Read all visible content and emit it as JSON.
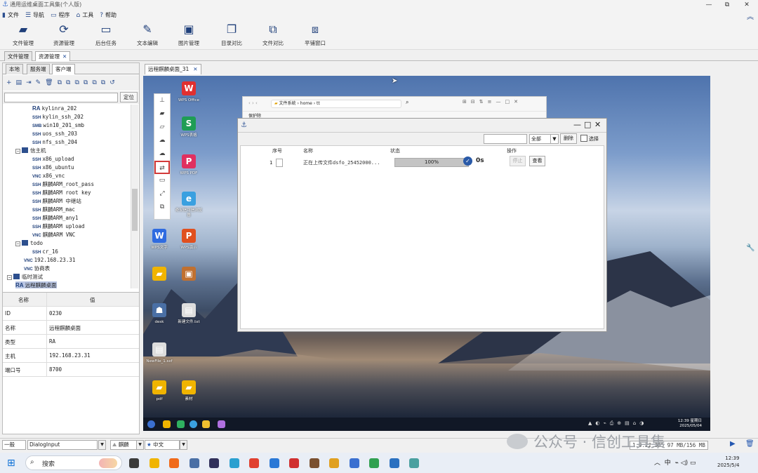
{
  "window": {
    "title": "通用运维桌面工具集(个人版)",
    "controls": [
      "—",
      "⧉",
      "✕"
    ]
  },
  "menu": [
    {
      "icon": "file-icon",
      "glyph": "▮",
      "label": "文件"
    },
    {
      "icon": "nav-icon",
      "glyph": "☰",
      "label": "导航"
    },
    {
      "icon": "program-icon",
      "glyph": "▭",
      "label": "程序"
    },
    {
      "icon": "tools-icon",
      "glyph": "⌂",
      "label": "工具"
    },
    {
      "icon": "help-icon",
      "glyph": "?",
      "label": "帮助"
    }
  ],
  "toolbar": [
    {
      "icon": "folder-open-icon",
      "glyph": "▰",
      "label": "文件管理"
    },
    {
      "icon": "resource-icon",
      "glyph": "⟳",
      "label": "资源管理"
    },
    {
      "icon": "monitor-icon",
      "glyph": "▭",
      "label": "后台任务"
    },
    {
      "icon": "edit-icon",
      "glyph": "✎",
      "label": "文本编辑"
    },
    {
      "icon": "image-icon",
      "glyph": "▣",
      "label": "图片管理"
    },
    {
      "icon": "dir-compare-icon",
      "glyph": "❐",
      "label": "目录对比"
    },
    {
      "icon": "file-compare-icon",
      "glyph": "⧉",
      "label": "文件对比"
    },
    {
      "icon": "tile-window-icon",
      "glyph": "⧈",
      "label": "平铺窗口"
    }
  ],
  "module_tabs": [
    {
      "label": "文件管理",
      "closable": false
    },
    {
      "label": "资源管理",
      "closable": true
    }
  ],
  "left": {
    "tabs": [
      "本地",
      "服务端",
      "客户端"
    ],
    "tools": [
      "+",
      "▤",
      "⇥",
      "✎",
      "🗑",
      "⧉",
      "⧉",
      "⧉",
      "⧉",
      "⧉",
      "⧉",
      "↺"
    ],
    "locate": "定位",
    "tree": [
      {
        "proto": "RA",
        "label": "kylinra_202",
        "indent": 42,
        "kind": "leaf"
      },
      {
        "proto": "SSH",
        "label": "kylin_ssh_202",
        "indent": 42,
        "kind": "leaf"
      },
      {
        "proto": "SMB",
        "label": "win10_201_smb",
        "indent": 42,
        "kind": "leaf"
      },
      {
        "proto": "SSH",
        "label": "uos_ssh_203",
        "indent": 42,
        "kind": "leaf"
      },
      {
        "proto": "SSH",
        "label": "nfs_ssh_204",
        "indent": 42,
        "kind": "leaf"
      },
      {
        "proto": "",
        "label": "信主机",
        "indent": 18,
        "kind": "folder"
      },
      {
        "proto": "SSH",
        "label": "x86_upload",
        "indent": 42,
        "kind": "leaf"
      },
      {
        "proto": "SSH",
        "label": "x86_ubuntu",
        "indent": 42,
        "kind": "leaf"
      },
      {
        "proto": "VNC",
        "label": "x86_vnc",
        "indent": 42,
        "kind": "leaf"
      },
      {
        "proto": "SSH",
        "label": "麒麟ARM_root_pass",
        "indent": 42,
        "kind": "leaf"
      },
      {
        "proto": "SSH",
        "label": "麒麟ARM root key",
        "indent": 42,
        "kind": "leaf"
      },
      {
        "proto": "SSH",
        "label": "麒麟ARM 中继站",
        "indent": 42,
        "kind": "leaf"
      },
      {
        "proto": "SSH",
        "label": "麒麟ARM_mac",
        "indent": 42,
        "kind": "leaf"
      },
      {
        "proto": "SSH",
        "label": "麒麟ARM_any1",
        "indent": 42,
        "kind": "leaf"
      },
      {
        "proto": "SSH",
        "label": "麒麟ARM upload",
        "indent": 42,
        "kind": "leaf"
      },
      {
        "proto": "VNC",
        "label": "麒麟ARM VNC",
        "indent": 42,
        "kind": "leaf"
      },
      {
        "proto": "",
        "label": "todo",
        "indent": 18,
        "kind": "folder"
      },
      {
        "proto": "SSH",
        "label": "cr_16",
        "indent": 42,
        "kind": "leaf"
      },
      {
        "proto": "VNC",
        "label": "192.168.23.31",
        "indent": 30,
        "kind": "leaf"
      },
      {
        "proto": "VNC",
        "label": "协商表",
        "indent": 30,
        "kind": "leaf"
      },
      {
        "proto": "",
        "label": "临时测试",
        "indent": 6,
        "kind": "folder"
      },
      {
        "proto": "RA",
        "label": "远程麒麟桌面",
        "indent": 18,
        "kind": "leaf",
        "selected": true
      }
    ],
    "props_header": {
      "name": "名称",
      "value": "值"
    },
    "props": [
      {
        "k": "ID",
        "v": "0230"
      },
      {
        "k": "名称",
        "v": "远程麒麟桌面"
      },
      {
        "k": "类型",
        "v": "RA"
      },
      {
        "k": "主机",
        "v": "192.168.23.31"
      },
      {
        "k": "端口号",
        "v": "8700"
      }
    ]
  },
  "content_tab": {
    "label": "远程麒麟桌面_31"
  },
  "remote": {
    "icons_col1": [
      {
        "label": "WPS文字",
        "color": "#2f6be0",
        "glyph": "W"
      },
      {
        "label": "",
        "color": "#f0b400",
        "glyph": "▰"
      },
      {
        "label": "desk",
        "color": "#4a6fa5",
        "glyph": "☗"
      },
      {
        "label": "NewFile_1.sxf",
        "color": "#dddddd",
        "glyph": "▤"
      },
      {
        "label": "pdf",
        "color": "#f0b400",
        "glyph": "▰"
      }
    ],
    "icons_col2": [
      {
        "label": "WPS Office",
        "color": "#e03030",
        "glyph": "W"
      },
      {
        "label": "WPS表格",
        "color": "#1f9d55",
        "glyph": "S"
      },
      {
        "label": "WPS PDF",
        "color": "#e03060",
        "glyph": "P"
      },
      {
        "label": "奇安信可信浏览器",
        "color": "#3aa0e0",
        "glyph": "e"
      },
      {
        "label": "WPS演示",
        "color": "#e0501f",
        "glyph": "P"
      },
      {
        "label": "",
        "color": "#c07030",
        "glyph": "▣"
      },
      {
        "label": "新建文件.txt",
        "color": "#dddddd",
        "glyph": "▤"
      },
      {
        "label": "素材",
        "color": "#f0b400",
        "glyph": "▰"
      }
    ],
    "float_tools": [
      "⊥",
      "▰",
      "▱",
      "☁",
      "☁",
      "⇄",
      "▭",
      "⤢",
      "⧉"
    ],
    "file_window": {
      "path1": "文件系统",
      "path2": "home",
      "path3": "tt",
      "label": "保护除"
    },
    "transfer": {
      "filter": "全部",
      "delete": "删除",
      "select": "选择",
      "headers": {
        "index": "序号",
        "name": "名称",
        "status": "状态",
        "action": "操作"
      },
      "rows": [
        {
          "index": "1",
          "name": "正在上传文件dsfo_25452000...",
          "progress": 100,
          "progress_text": "100%",
          "elapsed": "0s",
          "stop": "停止",
          "view": "查看"
        }
      ]
    },
    "clock": {
      "time": "12:39 星期日",
      "date": "2025/05/04"
    }
  },
  "status": {
    "level": "一般",
    "input": "DialogInput",
    "lang1": "麒麟",
    "lang2": "中文",
    "right_text": "1.0.22.385  97 MB/156 MB"
  },
  "watermark": "公众号 · 信创工具集",
  "taskbar": {
    "search": "搜索",
    "tray": "中",
    "time": "12:39",
    "date": "2025/5/4"
  }
}
